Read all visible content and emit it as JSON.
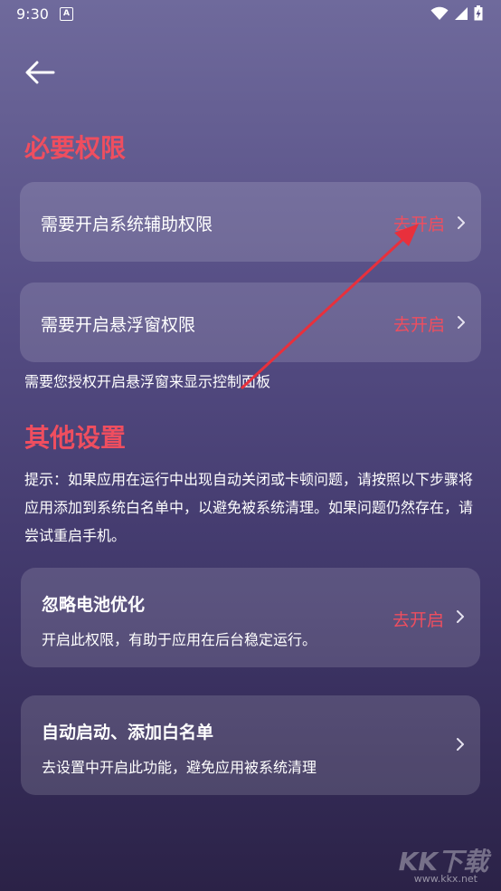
{
  "status_bar": {
    "time": "9:30",
    "notification_letter": "A"
  },
  "sections": {
    "required_title": "必要权限",
    "other_title": "其他设置"
  },
  "required": {
    "accessibility_label": "需要开启系统辅助权限",
    "overlay_label": "需要开启悬浮窗权限",
    "action_text": "去开启",
    "overlay_note": "需要您授权开启悬浮窗来显示控制面板"
  },
  "other": {
    "hint": "提示：如果应用在运行中出现自动关闭或卡顿问题，请按照以下步骤将应用添加到系统白名单中，以避免被系统清理。如果问题仍然存在，请尝试重启手机。",
    "battery_title": "忽略电池优化",
    "battery_desc": "开启此权限，有助于应用在后台稳定运行。",
    "battery_action": "去开启",
    "autostart_title": "自动启动、添加白名单",
    "autostart_desc": "去设置中开启此功能，避免应用被系统清理"
  },
  "watermark": {
    "brand": "KK下载",
    "url": "www.kkx.net"
  },
  "colors": {
    "accent": "#ef4e5f",
    "arrow": "#e8303c"
  },
  "icons": [
    "back-arrow-icon",
    "chevron-right-icon",
    "wifi-icon",
    "signal-icon",
    "battery-icon"
  ]
}
